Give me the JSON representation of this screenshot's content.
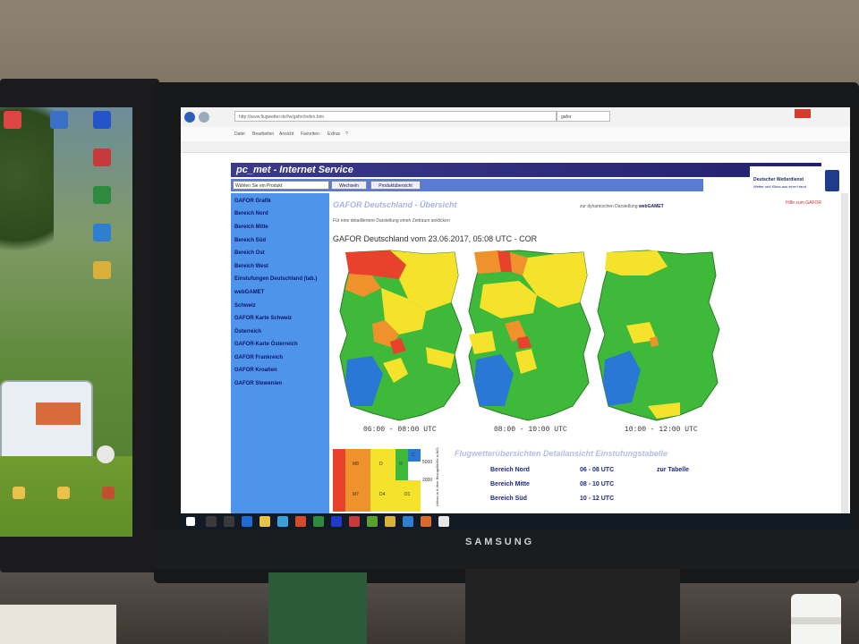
{
  "photo": {
    "monitor_brand": "SAMSUNG"
  },
  "browser": {
    "url": "http://www.flugwetter.de/fw/gafor/index.htm",
    "tab_title": "gafor",
    "menu_items": [
      "Datei",
      "Bearbeiten",
      "Ansicht",
      "Favoriten",
      "Extras",
      "?"
    ]
  },
  "page": {
    "banner_title": "pc_met - Internet Service",
    "dwd_name": "Deutscher Wetterdienst",
    "dwd_tagline": "Wetter und Klima aus einer Hand",
    "product_select_placeholder": "Wählen Sie ein Produkt",
    "btn_waehlen": "Wechseln",
    "btn_uebersicht": "Produktübersicht",
    "sidebar_items": [
      "GAFOR Grafik",
      "Bereich Nord",
      "Bereich Mitte",
      "Bereich Süd",
      "Bereich Ost",
      "Bereich West",
      "Einstufungen Deutschland (tab.)",
      "webGAMET",
      "Schweiz",
      "GAFOR Karte Schweiz",
      "Österreich",
      "GAFOR-Karte Österreich",
      "GAFOR Frankreich",
      "GAFOR Kroatien",
      "GAFOR Slowenien"
    ],
    "page_title": "GAFOR Deutschland - Übersicht",
    "dynamic_link_prefix": "zur dynamischen Darstellung",
    "dynamic_link": "webGAMET",
    "detail_hint": "Für eine detailliertere Darstellung einen Zeitraum anklicken",
    "pdf_link": "Hilfe zum GAFOR",
    "graphic_title": "GAFOR Deutschland vom 23.06.2017, 05:08 UTC - COR",
    "maps": [
      {
        "time": "06:00 - 08:00 UTC"
      },
      {
        "time": "08:00 - 10:00 UTC"
      },
      {
        "time": "10:00 - 12:00 UTC"
      }
    ],
    "legend": {
      "cells": [
        "M8",
        "D",
        "O",
        "C",
        "M7",
        "D4",
        "D1"
      ],
      "heights": [
        "5000",
        "2000"
      ],
      "side_note": "Höhen in ft über Bezugsfläche in ft/GAFOR Bezugsfläche"
    },
    "section_title": "Flugwetterübersichten Detailansicht Einstufungstabelle",
    "table_rows": [
      {
        "area": "Bereich Nord",
        "time": "06 - 08 UTC",
        "link": "zur Tabelle"
      },
      {
        "area": "Bereich Mitte",
        "time": "08 - 10 UTC",
        "link": ""
      },
      {
        "area": "Bereich Süd",
        "time": "10 - 12 UTC",
        "link": ""
      }
    ]
  },
  "colors": {
    "gafor_red": "#e8412c",
    "gafor_orange": "#f0922b",
    "gafor_yellow": "#f4e32a",
    "gafor_green": "#3fb93a",
    "gafor_blue": "#2a78d6",
    "sidebar": "#4d94ea",
    "banner": "#2b2880"
  }
}
